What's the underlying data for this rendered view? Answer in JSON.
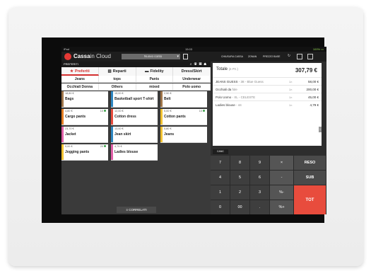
{
  "status": {
    "left": "iPad",
    "center": "15:03",
    "right": "100% ▭"
  },
  "header": {
    "brand_bold": "Cassa",
    "brand_light": "in Cloud",
    "new_account": "Nuovo conto",
    "buttons": [
      "CHIUSURA CASSA",
      "ZONAN",
      "PREZZO BASE"
    ]
  },
  "favorites_bar": {
    "label": "PREFERITI"
  },
  "tabs": [
    {
      "label": "Preferiti",
      "icon": "star-icon"
    },
    {
      "label": "Reparti",
      "icon": "grid-icon"
    },
    {
      "label": "Fidelity",
      "icon": "card-icon"
    },
    {
      "label": "Dress/Skirt",
      "icon": ""
    }
  ],
  "categories_row1": [
    "Jeans",
    "tops",
    "Pants",
    "Underwear"
  ],
  "categories_row2": [
    "Occhiali Donna",
    "Others",
    "mixed",
    "Polo uomo"
  ],
  "colors": {
    "brown": "#a0764a",
    "blue": "#2e86c1",
    "yellow": "#f1c232",
    "orange": "#e67e22",
    "pink": "#e05fa8",
    "red": "#e84c3d",
    "green": "#3fa34d"
  },
  "products": [
    {
      "price": "18,80 €",
      "qty": "",
      "name": "Bags",
      "color": "brown"
    },
    {
      "price": "15,00 €",
      "qty": "",
      "name": "Basketball sport T-shirt",
      "color": "blue"
    },
    {
      "price": "2,90 €",
      "qty": "",
      "name": "Belt",
      "color": "brown"
    },
    {
      "price": "4,80 €",
      "qty": "10",
      "name": "Cargo pants",
      "color": "orange"
    },
    {
      "price": "12,00 €",
      "qty": "",
      "name": "Cotton dress",
      "color": "red"
    },
    {
      "price": "5,00 €",
      "qty": "10",
      "name": "Cotton pants",
      "color": "yellow"
    },
    {
      "price": "23,70 €",
      "qty": "",
      "name": "Jacket",
      "color": "pink"
    },
    {
      "price": "13,00 €",
      "qty": "",
      "name": "Jean skirt",
      "color": "blue"
    },
    {
      "price": "5,80 €",
      "qty": "",
      "name": "Jeans",
      "color": "yellow"
    },
    {
      "price": "9,00 €",
      "qty": "20",
      "name": "Jogging pants",
      "color": "yellow"
    },
    {
      "price": "4,79 €",
      "qty": "",
      "name": "Ladies blouse",
      "color": "pink"
    }
  ],
  "correlati": "CORRELATI",
  "receipt": {
    "total_label": "Totale",
    "total_count": "(4 Pz.)",
    "total_value": "307,79 €",
    "lines": [
      {
        "name": "JEANS GUESS",
        "variant": "- 38 - Blue Guess",
        "qty": "1×",
        "price": "58,00 €"
      },
      {
        "name": "Occhiali da",
        "variant": "fole",
        "qty": "1×",
        "price": "200,00 €"
      },
      {
        "name": "Polo Uomo",
        "variant": "- XL - CELESTE",
        "qty": "1×",
        "price": "45,00 €"
      },
      {
        "name": "Ladies blouse",
        "variant": "- 44",
        "qty": "1×",
        "price": "4,79 €"
      }
    ]
  },
  "canc": "CANC",
  "keypad": {
    "rows": [
      [
        "7",
        "8",
        "9",
        "×",
        "RESO"
      ],
      [
        "4",
        "5",
        "6",
        "-",
        "SUB"
      ],
      [
        "1",
        "2",
        "3",
        "%-",
        "TOT"
      ],
      [
        "0",
        "00",
        ".",
        "%+",
        ""
      ]
    ]
  }
}
